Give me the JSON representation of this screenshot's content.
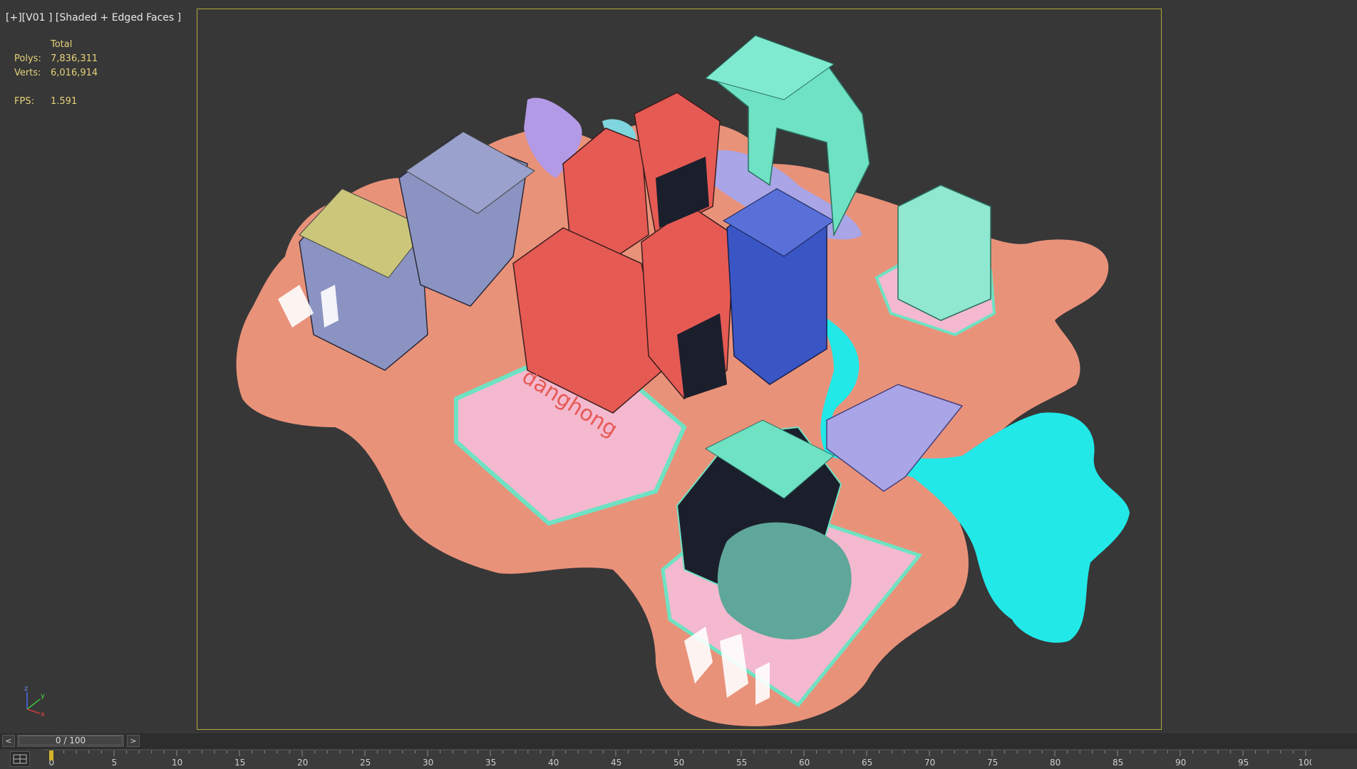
{
  "viewport": {
    "plus": "[+]",
    "view": "[V01 ]",
    "shading": "[Shaded + Edged Faces ]"
  },
  "stats": {
    "header": "Total",
    "polys_label": "Polys:",
    "polys_value": "7,836,311",
    "verts_label": "Verts:",
    "verts_value": "6,016,914",
    "fps_label": "FPS:",
    "fps_value": "1.591"
  },
  "scene": {
    "sign_text": "danghong",
    "colors": {
      "ground": "#e9927a",
      "water": "#22e8e8",
      "pink_floor": "#f4b9cf",
      "red_building": "#e65a54",
      "mint_structure": "#6ee2c3",
      "lavender": "#a9a5e6",
      "slate_building": "#8b93c2",
      "blue_building": "#3a55c4"
    }
  },
  "axis": {
    "x": "x",
    "y": "y",
    "z": "z"
  },
  "timeslider": {
    "prev": "<",
    "next": ">",
    "frame": "0 / 100"
  },
  "trackbar": {
    "ticks": [
      "0",
      "5",
      "10",
      "15",
      "20",
      "25",
      "30",
      "35",
      "40",
      "45",
      "50",
      "55",
      "60",
      "65",
      "70",
      "75",
      "80",
      "85",
      "90",
      "95",
      "100"
    ],
    "marker_color": "#d4b32a"
  }
}
